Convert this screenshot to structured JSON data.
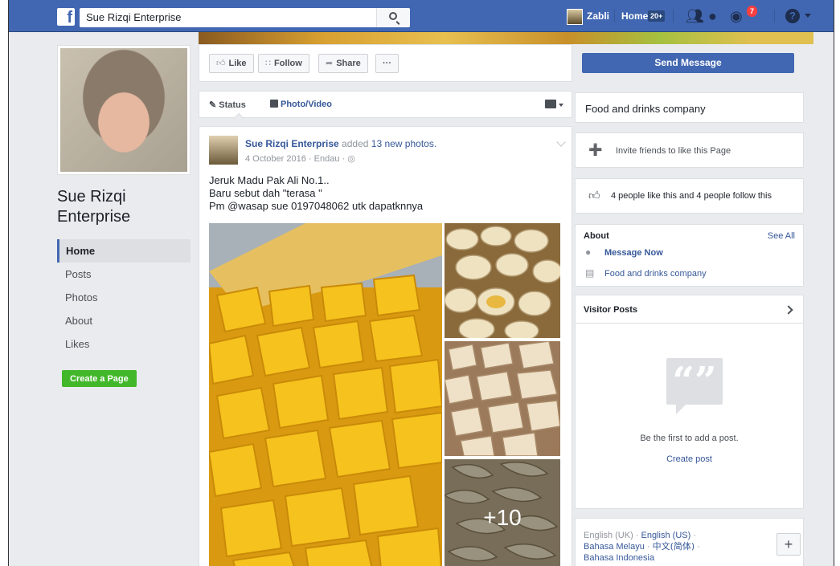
{
  "topbar": {
    "logo": "f",
    "search_value": "Sue Rizqi Enterprise",
    "user_name": "Zabli",
    "home_label": "Home",
    "home_badge": "20+",
    "notification_count": "7",
    "help_glyph": "?"
  },
  "sidebar": {
    "page_name": "Sue Rizqi Enterprise",
    "items": [
      {
        "label": "Home",
        "active": true
      },
      {
        "label": "Posts"
      },
      {
        "label": "Photos"
      },
      {
        "label": "About"
      },
      {
        "label": "Likes"
      }
    ],
    "create_page_label": "Create a Page"
  },
  "actions": {
    "like_label": "Like",
    "follow_label": "Follow",
    "share_label": "Share",
    "more_label": "···",
    "send_message_label": "Send Message"
  },
  "composer": {
    "status_label": "Status",
    "photo_video_label": "Photo/Video"
  },
  "post": {
    "author": "Sue Rizqi Enterprise",
    "verb": "added",
    "photos_text": "13 new photos.",
    "date": "4 October 2016",
    "location": "Endau",
    "lines": [
      "Jeruk Madu Pak Ali No.1..",
      "Baru sebut dah \"terasa \"",
      "Pm @wasap sue 0197048062 utk dapatknnya"
    ],
    "more_photos": "+10"
  },
  "right": {
    "category_title": "Food and drinks company",
    "invite_label": "Invite friends to like this Page",
    "likes_text": "4 people like this and 4 people follow this",
    "about_heading": "About",
    "see_all": "See All",
    "message_now": "Message Now",
    "about_category": "Food and drinks company",
    "visitor_posts_heading": "Visitor Posts",
    "first_post_text": "Be the first to add a post.",
    "create_post": "Create post",
    "languages": {
      "line1_plain": "English (UK) · ",
      "line1_link": "English (US)",
      "line1_sep": " ·",
      "line2_link": "Bahasa Melayu",
      "line2_sep": " · ",
      "line2_cjk": "中文(简体)",
      "line2_end": " ·",
      "line3_link": "Bahasa Indonesia",
      "plus": "+"
    }
  }
}
